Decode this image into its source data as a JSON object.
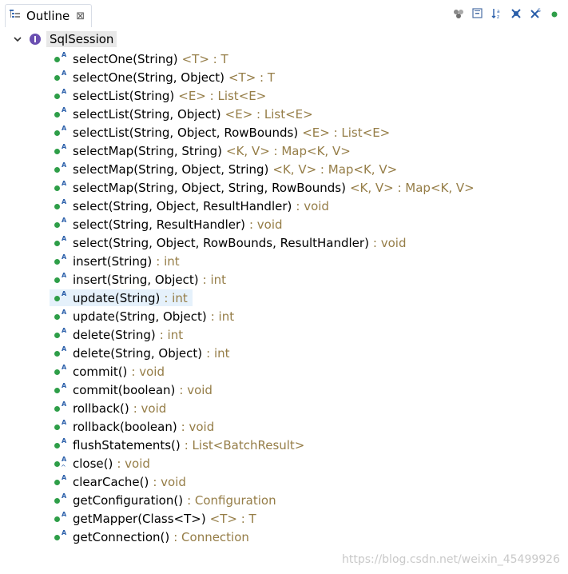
{
  "tab": {
    "title": "Outline",
    "close": "⊠"
  },
  "toolbar": {
    "icons": [
      "group-icon",
      "collapse-all-icon",
      "sort-icon",
      "hide-fields-icon",
      "hide-static-icon",
      "hide-non-public-icon"
    ]
  },
  "tree": {
    "root_label": "SqlSession",
    "members": [
      {
        "name": "selectOne(String)",
        "ret": "<T> : T"
      },
      {
        "name": "selectOne(String, Object)",
        "ret": "<T> : T"
      },
      {
        "name": "selectList(String)",
        "ret": "<E> : List<E>"
      },
      {
        "name": "selectList(String, Object)",
        "ret": "<E> : List<E>"
      },
      {
        "name": "selectList(String, Object, RowBounds)",
        "ret": "<E> : List<E>"
      },
      {
        "name": "selectMap(String, String)",
        "ret": "<K, V> : Map<K, V>"
      },
      {
        "name": "selectMap(String, Object, String)",
        "ret": "<K, V> : Map<K, V>"
      },
      {
        "name": "selectMap(String, Object, String, RowBounds)",
        "ret": "<K, V> : Map<K, V>"
      },
      {
        "name": "select(String, Object, ResultHandler)",
        "ret": ": void"
      },
      {
        "name": "select(String, ResultHandler)",
        "ret": ": void"
      },
      {
        "name": "select(String, Object, RowBounds, ResultHandler)",
        "ret": ": void"
      },
      {
        "name": "insert(String)",
        "ret": ": int"
      },
      {
        "name": "insert(String, Object)",
        "ret": ": int"
      },
      {
        "name": "update(String)",
        "ret": ": int",
        "selected": true
      },
      {
        "name": "update(String, Object)",
        "ret": ": int"
      },
      {
        "name": "delete(String)",
        "ret": ": int"
      },
      {
        "name": "delete(String, Object)",
        "ret": ": int"
      },
      {
        "name": "commit()",
        "ret": ": void"
      },
      {
        "name": "commit(boolean)",
        "ret": ": void"
      },
      {
        "name": "rollback()",
        "ret": ": void"
      },
      {
        "name": "rollback(boolean)",
        "ret": ": void"
      },
      {
        "name": "flushStatements()",
        "ret": ": List<BatchResult>"
      },
      {
        "name": "close()",
        "ret": ": void",
        "default_mark": true
      },
      {
        "name": "clearCache()",
        "ret": ": void"
      },
      {
        "name": "getConfiguration()",
        "ret": ": Configuration"
      },
      {
        "name": "getMapper(Class<T>)",
        "ret": "<T> : T"
      },
      {
        "name": "getConnection()",
        "ret": ": Connection"
      }
    ]
  },
  "watermark": "https://blog.csdn.net/weixin_45499926",
  "colors": {
    "method_dot": "#2e9e48",
    "return_type": "#957d47",
    "selection": "#e5f1fb"
  }
}
